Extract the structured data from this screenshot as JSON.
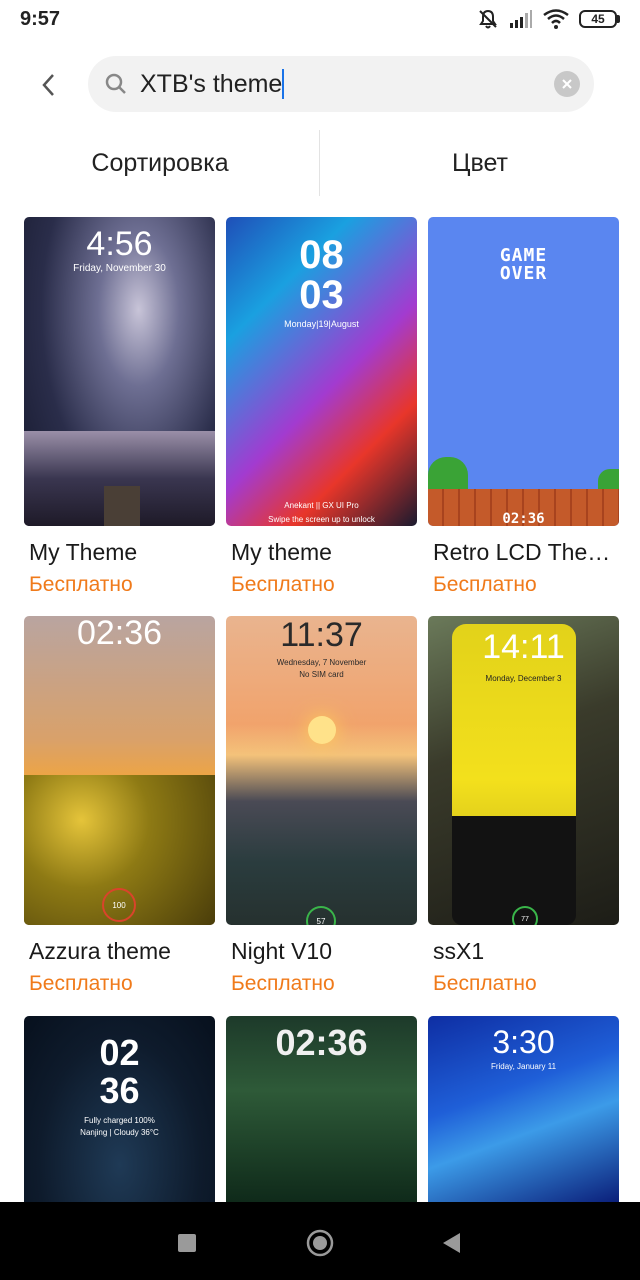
{
  "status": {
    "time": "9:57",
    "battery": "45",
    "icons": [
      "mute-icon",
      "signal-icon",
      "wifi-icon",
      "battery-icon"
    ]
  },
  "search": {
    "value": "XTB's theme",
    "icons": [
      "back-icon",
      "search-icon",
      "clear-icon"
    ]
  },
  "filters": {
    "sort_label": "Сортировка",
    "color_label": "Цвет"
  },
  "themes": [
    {
      "title": "My Theme",
      "price": "Бесплатно",
      "clock": "4:56",
      "date": "Friday, November 30"
    },
    {
      "title": "My theme",
      "price": "Бесплатно",
      "clock_top": "08",
      "clock_bottom": "03",
      "date": "Monday|19|August",
      "footer1": "Anekant || GX UI Pro",
      "footer2": "Swipe the screen up to unlock"
    },
    {
      "title": "Retro LCD The…",
      "price": "Бесплатно",
      "banner1": "GAME",
      "banner2": "OVER",
      "clock": "02:36"
    },
    {
      "title": "Azzura theme",
      "price": "Бесплатно",
      "clock": "02:36",
      "badge": "100"
    },
    {
      "title": "Night V10",
      "price": "Бесплатно",
      "clock": "11:37",
      "date": "Wednesday, 7 November",
      "subtitle": "No SIM card",
      "badge": "57"
    },
    {
      "title": "ssX1",
      "price": "Бесплатно",
      "clock": "14:11",
      "date": "Monday, December 3",
      "badge": "77"
    },
    {
      "clock_top": "02",
      "clock_bottom": "36",
      "line1": "Fully charged 100%",
      "line2": "Nanjing | Cloudy 36°C"
    },
    {
      "clock": "02:36"
    },
    {
      "clock": "3:30",
      "date": "Friday, January 11"
    }
  ],
  "colors": {
    "accent_price": "#f07a1a",
    "search_bg": "#f2f2f2",
    "caret": "#1a73e8",
    "nav_bg": "#000000"
  },
  "nav": {
    "icons": [
      "recents-icon",
      "home-icon",
      "back-nav-icon"
    ]
  }
}
